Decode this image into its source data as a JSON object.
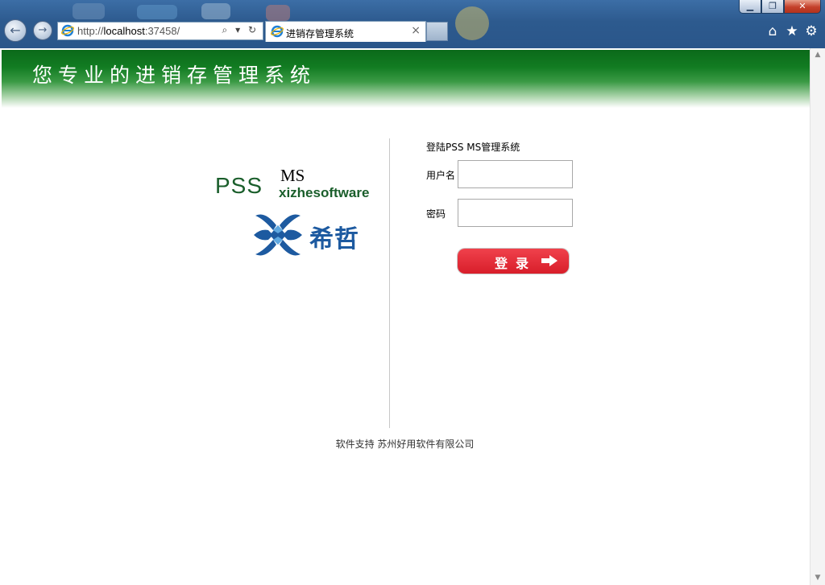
{
  "browser": {
    "url_prefix": "http://",
    "url_host": "localhost",
    "url_rest": ":37458/",
    "tab_title": "进销存管理系统",
    "tab_close": "×",
    "search_dropdown": "⌕ ▾",
    "refresh": "↻",
    "window": {
      "minimize": "▁",
      "restore": "❐",
      "close": "✕"
    },
    "icons": [
      "home-icon",
      "favorites-star-icon",
      "settings-gear-icon"
    ]
  },
  "banner": {
    "slogan": "您专业的进销存管理系统"
  },
  "logo": {
    "product": "PSS",
    "product_suffix": "MS",
    "company_en": "xizhesoftware",
    "company_cn": "希哲"
  },
  "form": {
    "title": "登陆PSS MS管理系统",
    "username_label": "用户名",
    "password_label": "密码",
    "username_value": "",
    "password_value": "",
    "submit_label": "登录",
    "submit_arrow": "➡"
  },
  "footer": {
    "text": "软件支持 苏州好用软件有限公司"
  },
  "colors": {
    "banner_green": "#127c22",
    "logo_green": "#1a5e2b",
    "logo_blue": "#1d5aa0",
    "button_red": "#e02a35"
  }
}
